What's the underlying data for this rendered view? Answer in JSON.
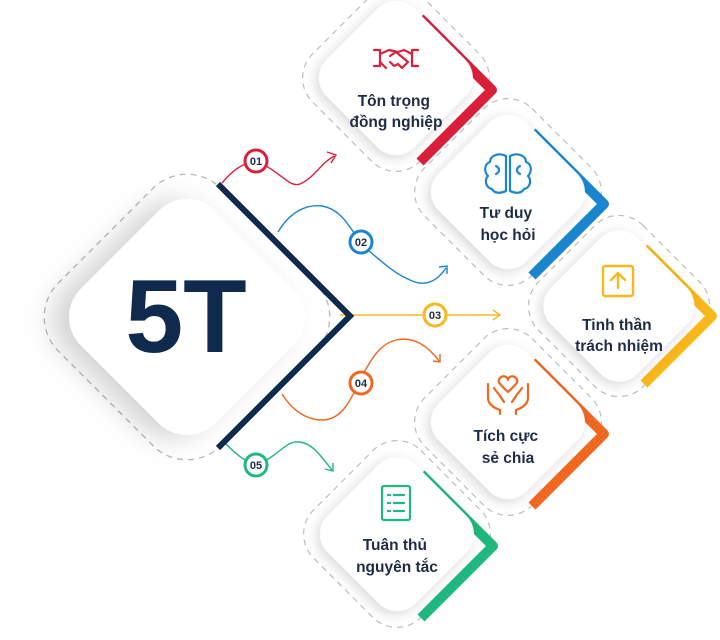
{
  "center": {
    "label": "5T",
    "color": "#0f2a4d"
  },
  "items": [
    {
      "number": "01",
      "line1": "Tôn trọng",
      "line2": "đồng nghiệp",
      "color": "#d91f3a",
      "icon": "handshake-icon"
    },
    {
      "number": "02",
      "line1": "Tư duy",
      "line2": "học hỏi",
      "color": "#1a86d0",
      "icon": "brain-icon"
    },
    {
      "number": "03",
      "line1": "Tinh thần",
      "line2": "trách nhiệm",
      "color": "#f7b81b",
      "icon": "upload-box-icon"
    },
    {
      "number": "04",
      "line1": "Tích cực",
      "line2": "sẻ chia",
      "color": "#f0671f",
      "icon": "hands-heart-icon"
    },
    {
      "number": "05",
      "line1": "Tuân thủ",
      "line2": "nguyên tắc",
      "color": "#1fb87e",
      "icon": "checklist-icon"
    }
  ]
}
